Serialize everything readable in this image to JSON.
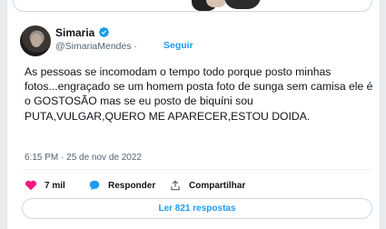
{
  "author": {
    "name": "Simaria",
    "handle": "@SimariaMendes",
    "separator": "·",
    "follow_label": "Seguir"
  },
  "tweet": {
    "text": "As pessoas se incomodam o tempo todo porque posto minhas fotos...engraçado se um homem posta foto de sunga sem camisa ele é o GOSTOSÃO mas se eu posto de biquíni sou PUTA,VULGAR,QUERO ME APARECER,ESTOU DOIDA.",
    "timestamp": "6:15 PM · 25 de nov de 2022"
  },
  "actions": {
    "likes": "7 mil",
    "reply_label": "Responder",
    "share_label": "Compartilhar"
  },
  "replies_button": "Ler 821 respostas",
  "colors": {
    "accent": "#1d9bf0",
    "like": "#f91880",
    "text": "#0f1419",
    "secondary": "#536471"
  }
}
